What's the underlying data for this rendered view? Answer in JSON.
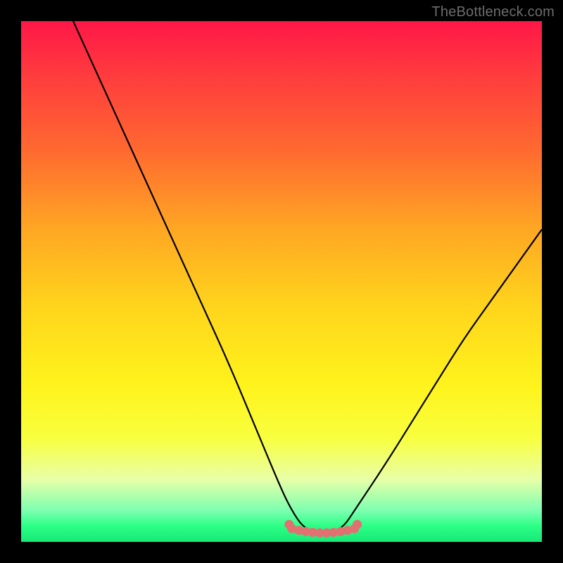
{
  "watermark": "TheBottleneck.com",
  "chart_data": {
    "type": "line",
    "title": "",
    "xlabel": "",
    "ylabel": "",
    "xlim": [
      0,
      100
    ],
    "ylim": [
      0,
      100
    ],
    "series": [
      {
        "name": "bottleneck-curve",
        "x": [
          10,
          15,
          20,
          25,
          30,
          35,
          40,
          45,
          50,
          52,
          54,
          56,
          58,
          60,
          62,
          64,
          70,
          75,
          80,
          85,
          90,
          95,
          100
        ],
        "y": [
          100,
          89,
          78,
          67,
          56,
          45,
          34,
          22,
          10,
          6,
          3,
          2,
          2,
          2,
          3,
          6,
          15,
          23,
          31,
          39,
          46,
          53,
          60
        ]
      }
    ],
    "annotations": [
      {
        "name": "optimal-region-marker",
        "x_range": [
          52,
          64
        ],
        "y": 2,
        "color": "#e27070",
        "style": "thick-dotted"
      }
    ],
    "gradient_background": {
      "type": "vertical",
      "stops": [
        {
          "pos": 0.0,
          "color": "#ff1747"
        },
        {
          "pos": 0.25,
          "color": "#ff6a30"
        },
        {
          "pos": 0.55,
          "color": "#ffd51c"
        },
        {
          "pos": 0.8,
          "color": "#f8ff3e"
        },
        {
          "pos": 0.94,
          "color": "#7cffb0"
        },
        {
          "pos": 1.0,
          "color": "#17e876"
        }
      ]
    }
  }
}
